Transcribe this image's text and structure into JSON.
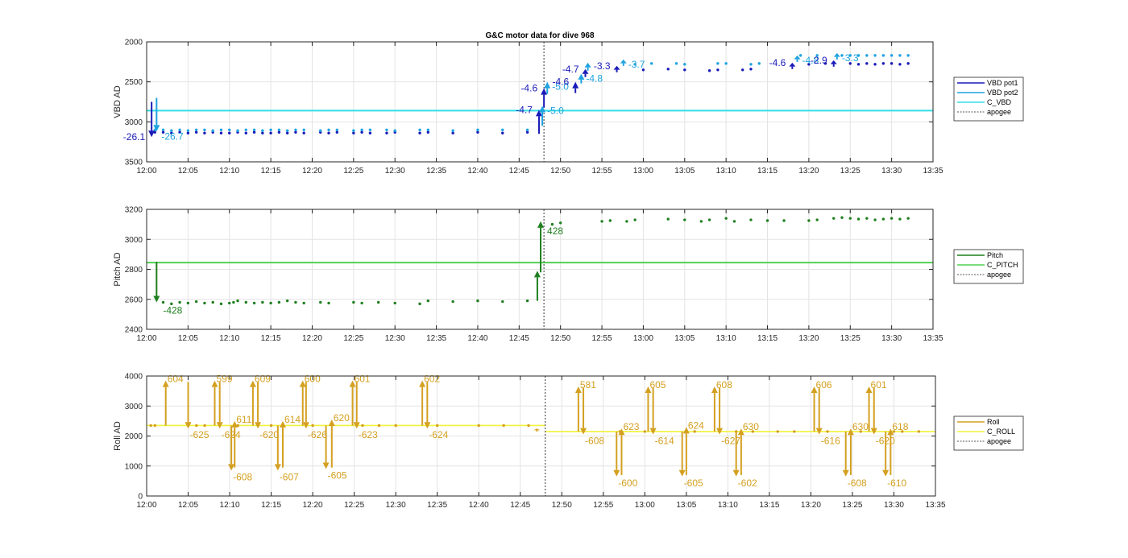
{
  "title": "G&C motor data for dive 968",
  "chart_data": [
    {
      "type": "scatter",
      "name": "vbd",
      "ylabel": "VBD AD",
      "xlim": [
        "12:00",
        "13:35"
      ],
      "xticks": [
        "12:00",
        "12:05",
        "12:10",
        "12:15",
        "12:20",
        "12:25",
        "12:30",
        "12:35",
        "12:40",
        "12:45",
        "12:50",
        "12:55",
        "13:00",
        "13:05",
        "13:10",
        "13:15",
        "13:20",
        "13:25",
        "13:30",
        "13:35"
      ],
      "ylim": [
        2000,
        3500
      ],
      "y_reversed": true,
      "yticks": [
        2000,
        2500,
        3000,
        3500
      ],
      "grid": true,
      "legend_position": "right",
      "legend": [
        "VBD pot1",
        "VBD pot2",
        "C_VBD",
        "apogee"
      ],
      "colors": {
        "pot1": "#1a1ab8",
        "pot2": "#1ea3e0",
        "cline": "#33dde6",
        "apogee": "#555555"
      },
      "c_value": 2860,
      "apogee": "12:48",
      "series": [
        {
          "name": "VBD pot1",
          "x": [
            "12:01",
            "12:02",
            "12:03",
            "12:04",
            "12:05",
            "12:06",
            "12:07",
            "12:08",
            "12:09",
            "12:10",
            "12:11",
            "12:12",
            "12:13",
            "12:14",
            "12:15",
            "12:16",
            "12:17",
            "12:18",
            "12:19",
            "12:21",
            "12:22",
            "12:23",
            "12:25",
            "12:26",
            "12:27",
            "12:29",
            "12:30",
            "12:33",
            "12:34",
            "12:37",
            "12:40",
            "12:43",
            "12:46",
            "13:00",
            "13:03",
            "13:05",
            "13:08",
            "13:09",
            "13:12",
            "13:13",
            "13:20",
            "13:22",
            "13:25",
            "13:26",
            "13:27",
            "13:28",
            "13:29",
            "13:30",
            "13:31",
            "13:32"
          ],
          "y": [
            3130,
            3130,
            3140,
            3130,
            3140,
            3130,
            3140,
            3130,
            3140,
            3140,
            3130,
            3140,
            3130,
            3140,
            3140,
            3130,
            3140,
            3130,
            3140,
            3130,
            3140,
            3130,
            3140,
            3130,
            3140,
            3140,
            3130,
            3140,
            3130,
            3140,
            3130,
            3140,
            3130,
            2350,
            2340,
            2350,
            2360,
            2350,
            2350,
            2340,
            2280,
            2270,
            2270,
            2280,
            2270,
            2280,
            2270,
            2270,
            2280,
            2270
          ]
        },
        {
          "name": "VBD pot2",
          "x": [
            "12:01",
            "12:02",
            "12:03",
            "12:04",
            "12:05",
            "12:06",
            "12:07",
            "12:08",
            "12:09",
            "12:10",
            "12:11",
            "12:12",
            "12:13",
            "12:14",
            "12:15",
            "12:16",
            "12:17",
            "12:18",
            "12:19",
            "12:21",
            "12:22",
            "12:23",
            "12:25",
            "12:26",
            "12:27",
            "12:29",
            "12:30",
            "12:33",
            "12:34",
            "12:37",
            "12:40",
            "12:43",
            "12:46",
            "12:59",
            "13:01",
            "13:04",
            "13:05",
            "13:09",
            "13:10",
            "13:13",
            "13:14",
            "13:19",
            "13:21",
            "13:24",
            "13:25",
            "13:26",
            "13:27",
            "13:28",
            "13:29",
            "13:30",
            "13:31",
            "13:32"
          ],
          "y": [
            3100,
            3100,
            3110,
            3100,
            3110,
            3100,
            3100,
            3110,
            3100,
            3100,
            3110,
            3100,
            3100,
            3110,
            3100,
            3100,
            3110,
            3100,
            3100,
            3110,
            3100,
            3100,
            3110,
            3100,
            3100,
            3100,
            3110,
            3100,
            3100,
            3110,
            3100,
            3100,
            3100,
            2280,
            2270,
            2270,
            2280,
            2270,
            2270,
            2280,
            2270,
            2170,
            2170,
            2170,
            2170,
            2170,
            2170,
            2170,
            2170,
            2170,
            2170,
            2170
          ]
        }
      ],
      "arrows": [
        {
          "series": "pot1",
          "x": "12:00.6",
          "from": 2750,
          "to": 3190,
          "label": "-26.1"
        },
        {
          "series": "pot2",
          "x": "12:01.2",
          "from": 2700,
          "to": 3120,
          "label": "-26.7"
        },
        {
          "series": "pot1",
          "x": "12:47.4",
          "from": 3150,
          "to": 2850,
          "label": "-4.7"
        },
        {
          "series": "pot2",
          "x": "12:47.8",
          "from": 3050,
          "to": 2800,
          "label": "-5.0"
        },
        {
          "series": "pot1",
          "x": "12:48.0",
          "from": 2820,
          "to": 2580,
          "label": "-4.6"
        },
        {
          "series": "pot2",
          "x": "12:48.4",
          "from": 2650,
          "to": 2500,
          "label": "-5.0"
        },
        {
          "series": "pot1",
          "x": "12:51.8",
          "from": 2640,
          "to": 2500,
          "label": "-4.6"
        },
        {
          "series": "pot2",
          "x": "12:52.5",
          "from": 2520,
          "to": 2400,
          "label": "-4.8"
        },
        {
          "series": "pot1",
          "x": "12:53.0",
          "from": 2440,
          "to": 2340,
          "label": "-4.7"
        },
        {
          "series": "pot2",
          "x": "12:53.3",
          "from": 2360,
          "to": 2260,
          "label": ""
        },
        {
          "series": "pot1",
          "x": "12:56.8",
          "from": 2380,
          "to": 2300,
          "label": "-3.3"
        },
        {
          "series": "pot2",
          "x": "12:57.6",
          "from": 2300,
          "to": 2220,
          "label": "-3.7"
        },
        {
          "series": "pot1",
          "x": "13:18.0",
          "from": 2340,
          "to": 2260,
          "label": "-4.6"
        },
        {
          "series": "pot2",
          "x": "13:18.6",
          "from": 2250,
          "to": 2170,
          "label": "-4.8"
        },
        {
          "series": "pot1",
          "x": "13:23.0",
          "from": 2310,
          "to": 2230,
          "label": "-2.9"
        },
        {
          "series": "pot2",
          "x": "13:23.4",
          "from": 2220,
          "to": 2140,
          "label": "-3.3"
        }
      ]
    },
    {
      "type": "scatter",
      "name": "pitch",
      "ylabel": "Pitch AD",
      "xlim": [
        "12:00",
        "13:35"
      ],
      "xticks": [
        "12:00",
        "12:05",
        "12:10",
        "12:15",
        "12:20",
        "12:25",
        "12:30",
        "12:35",
        "12:40",
        "12:45",
        "12:50",
        "12:55",
        "13:00",
        "13:05",
        "13:10",
        "13:15",
        "13:20",
        "13:25",
        "13:30",
        "13:35"
      ],
      "ylim": [
        2400,
        3200
      ],
      "yticks": [
        2400,
        2600,
        2800,
        3000,
        3200
      ],
      "grid": true,
      "legend_position": "right",
      "legend": [
        "Pitch",
        "C_PITCH",
        "apogee"
      ],
      "colors": {
        "pitch": "#1f7f1f",
        "cline": "#50d050",
        "apogee": "#555555"
      },
      "c_value": 2845,
      "apogee": "12:48",
      "series": [
        {
          "name": "Pitch",
          "x": [
            "12:02",
            "12:03",
            "12:04",
            "12:05",
            "12:06",
            "12:07",
            "12:08",
            "12:09",
            "12:10",
            "12:10.5",
            "12:11",
            "12:12",
            "12:13",
            "12:14",
            "12:15",
            "12:16",
            "12:17",
            "12:18",
            "12:19",
            "12:21",
            "12:22",
            "12:25",
            "12:26",
            "12:28",
            "12:30",
            "12:33",
            "12:34",
            "12:37",
            "12:40",
            "12:43",
            "12:46",
            "12:49",
            "12:50",
            "12:55",
            "12:56",
            "12:58",
            "12:59",
            "13:03",
            "13:05",
            "13:07",
            "13:08",
            "13:10",
            "13:11",
            "13:13",
            "13:15",
            "13:17",
            "13:20",
            "13:21",
            "13:23",
            "13:24",
            "13:25",
            "13:26",
            "13:27",
            "13:28",
            "13:29",
            "13:30",
            "13:31",
            "13:32"
          ],
          "y": [
            2580,
            2570,
            2580,
            2575,
            2585,
            2575,
            2580,
            2570,
            2575,
            2580,
            2590,
            2580,
            2575,
            2580,
            2575,
            2580,
            2590,
            2580,
            2575,
            2580,
            2575,
            2580,
            2575,
            2580,
            2575,
            2570,
            2590,
            2585,
            2590,
            2585,
            2590,
            3100,
            3110,
            3120,
            3125,
            3120,
            3130,
            3135,
            3130,
            3120,
            3130,
            3140,
            3120,
            3130,
            3125,
            3125,
            3125,
            3130,
            3140,
            3145,
            3140,
            3135,
            3140,
            3130,
            3135,
            3140,
            3135,
            3140
          ]
        }
      ],
      "arrows": [
        {
          "x": "12:01.2",
          "from": 2850,
          "to": 2580,
          "label": "-428"
        },
        {
          "x": "12:47.2",
          "from": 2590,
          "to": 2790,
          "label": ""
        },
        {
          "x": "12:47.6",
          "from": 2780,
          "to": 3120,
          "label": "428"
        }
      ]
    },
    {
      "type": "scatter",
      "name": "roll",
      "ylabel": "Roll AD",
      "xlim": [
        "12:00",
        "13:35"
      ],
      "xticks": [
        "12:00",
        "12:05",
        "12:10",
        "12:15",
        "12:20",
        "12:25",
        "12:30",
        "12:35",
        "12:40",
        "12:45",
        "12:50",
        "12:55",
        "13:00",
        "13:05",
        "13:10",
        "13:15",
        "13:20",
        "13:25",
        "13:30",
        "13:35"
      ],
      "ylim": [
        0,
        4000
      ],
      "yticks": [
        0,
        1000,
        2000,
        3000,
        4000
      ],
      "grid": true,
      "legend_position": "right",
      "legend": [
        "Roll",
        "C_ROLL",
        "apogee"
      ],
      "colors": {
        "roll": "#d4a020",
        "cline": "#f2f23a",
        "apogee": "#555555"
      },
      "c_roll": [
        {
          "from": "12:00",
          "to": "12:48",
          "value": 2350
        },
        {
          "from": "12:48",
          "to": "13:35",
          "value": 2150
        }
      ],
      "apogee": "12:48",
      "series": [
        {
          "name": "Roll",
          "x": [
            "12:00.5",
            "12:01",
            "12:06",
            "12:07",
            "12:11",
            "12:15",
            "12:20",
            "12:26",
            "12:28",
            "12:30",
            "12:35",
            "12:40",
            "12:43",
            "12:46",
            "12:57",
            "13:00",
            "13:06",
            "13:11",
            "13:13",
            "13:16",
            "13:18",
            "13:22",
            "13:26",
            "13:30",
            "13:31",
            "13:33"
          ],
          "y": [
            2350,
            2350,
            2350,
            2350,
            2350,
            2350,
            2350,
            2350,
            2350,
            2350,
            2350,
            2350,
            2350,
            2350,
            2150,
            2150,
            2150,
            2150,
            2150,
            2150,
            2150,
            2150,
            2150,
            2150,
            2150,
            2150
          ]
        }
      ],
      "arrows": [
        {
          "x": "12:02.3",
          "from": 2350,
          "to": 3850,
          "label": "604"
        },
        {
          "x": "12:05.0",
          "from": 3800,
          "to": 2250,
          "label": "-625"
        },
        {
          "x": "12:08.2",
          "from": 2350,
          "to": 3850,
          "label": "599"
        },
        {
          "x": "12:08.8",
          "from": 3800,
          "to": 2250,
          "label": "-624"
        },
        {
          "x": "12:10.2",
          "from": 2350,
          "to": 850,
          "label": "-608"
        },
        {
          "x": "12:10.6",
          "from": 950,
          "to": 2500,
          "label": "611"
        },
        {
          "x": "12:12.8",
          "from": 2350,
          "to": 3850,
          "label": "609"
        },
        {
          "x": "12:13.4",
          "from": 3800,
          "to": 2250,
          "label": "-620"
        },
        {
          "x": "12:15.8",
          "from": 2350,
          "to": 850,
          "label": "-607"
        },
        {
          "x": "12:16.4",
          "from": 950,
          "to": 2500,
          "label": "614"
        },
        {
          "x": "12:18.8",
          "from": 2350,
          "to": 3850,
          "label": "600"
        },
        {
          "x": "12:19.2",
          "from": 3800,
          "to": 2250,
          "label": "-626"
        },
        {
          "x": "12:21.6",
          "from": 2350,
          "to": 900,
          "label": "-605"
        },
        {
          "x": "12:22.3",
          "from": 950,
          "to": 2550,
          "label": "620"
        },
        {
          "x": "12:24.8",
          "from": 2350,
          "to": 3850,
          "label": "601"
        },
        {
          "x": "12:25.3",
          "from": 3800,
          "to": 2250,
          "label": "-623"
        },
        {
          "x": "12:33.2",
          "from": 2350,
          "to": 3850,
          "label": "602"
        },
        {
          "x": "12:33.8",
          "from": 3800,
          "to": 2250,
          "label": "-624"
        },
        {
          "x": "12:47.0",
          "from": 2150,
          "to": 2250,
          "label": ""
        },
        {
          "x": "12:52.0",
          "from": 2150,
          "to": 3650,
          "label": "581"
        },
        {
          "x": "12:52.6",
          "from": 3600,
          "to": 2050,
          "label": "-608"
        },
        {
          "x": "12:56.6",
          "from": 2150,
          "to": 650,
          "label": "-600"
        },
        {
          "x": "12:57.2",
          "from": 700,
          "to": 2250,
          "label": "623"
        },
        {
          "x": "13:00.4",
          "from": 2150,
          "to": 3650,
          "label": "605"
        },
        {
          "x": "13:01.0",
          "from": 3600,
          "to": 2050,
          "label": "-614"
        },
        {
          "x": "13:04.5",
          "from": 2150,
          "to": 650,
          "label": "-605"
        },
        {
          "x": "13:05.0",
          "from": 700,
          "to": 2300,
          "label": "624"
        },
        {
          "x": "13:08.4",
          "from": 2150,
          "to": 3650,
          "label": "608"
        },
        {
          "x": "13:09.0",
          "from": 3600,
          "to": 2050,
          "label": "-627"
        },
        {
          "x": "13:11.0",
          "from": 2150,
          "to": 650,
          "label": "-602"
        },
        {
          "x": "13:11.6",
          "from": 700,
          "to": 2250,
          "label": "630"
        },
        {
          "x": "13:20.4",
          "from": 2150,
          "to": 3650,
          "label": "606"
        },
        {
          "x": "13:21.0",
          "from": 3600,
          "to": 2050,
          "label": "-616"
        },
        {
          "x": "13:24.2",
          "from": 2150,
          "to": 650,
          "label": "-608"
        },
        {
          "x": "13:24.8",
          "from": 700,
          "to": 2250,
          "label": "630"
        },
        {
          "x": "13:27.0",
          "from": 2150,
          "to": 3650,
          "label": "601"
        },
        {
          "x": "13:27.6",
          "from": 3600,
          "to": 2050,
          "label": "-620"
        },
        {
          "x": "13:29.0",
          "from": 2150,
          "to": 650,
          "label": "-610"
        },
        {
          "x": "13:29.6",
          "from": 700,
          "to": 2250,
          "label": "618"
        }
      ]
    }
  ]
}
